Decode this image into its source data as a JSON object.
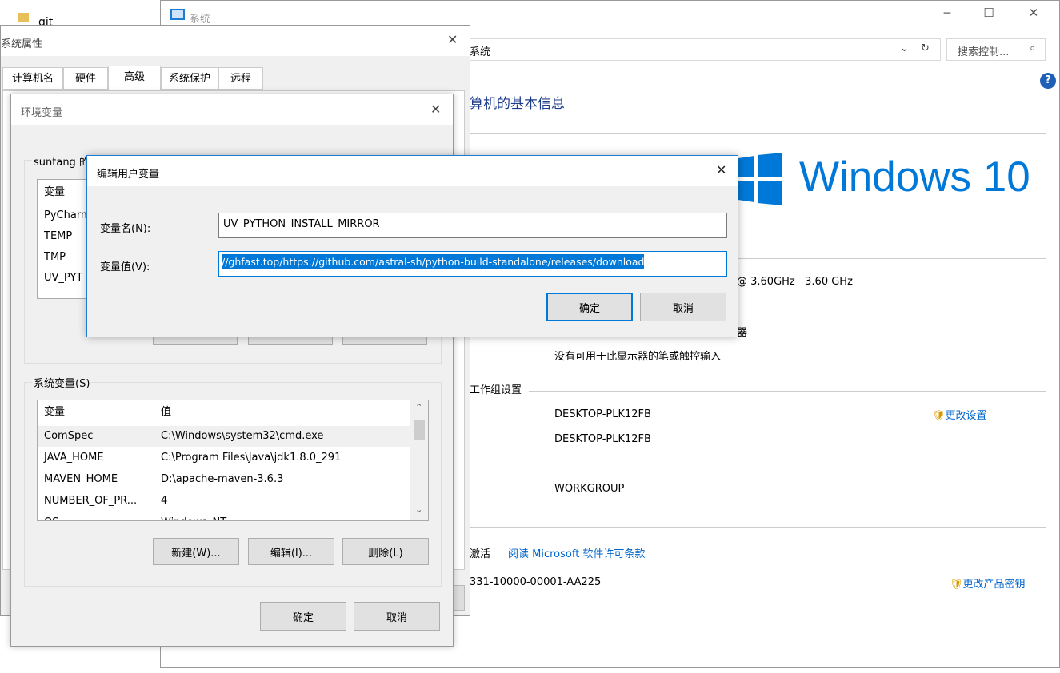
{
  "desktop": {
    "folder_label": "git"
  },
  "system_window": {
    "title": "系统",
    "address": "系统",
    "search_placeholder": "搜索控制... ",
    "heading": "算机的基本信息",
    "windows_logo_text": "Windows",
    "windows_logo_version": "10",
    "cpu_speed": "@ 3.60GHz   3.60 GHz",
    "partial_display": "器",
    "pen_touch": "没有可用于此显示器的笔或触控输入",
    "workgroup_section": "工作组设置",
    "computer_name": "DESKTOP-PLK12FB",
    "full_name": "DESKTOP-PLK12FB",
    "workgroup": "WORKGROUP",
    "change_settings": "更改设置",
    "activation_prefix": "激活",
    "license_link": "阅读 Microsoft 软件许可条款",
    "product_id": "331-10000-00001-AA225",
    "change_product_key": "更改产品密钥"
  },
  "sys_props": {
    "title": "系统属性",
    "tabs": [
      "计算机名",
      "硬件",
      "高级",
      "系统保护",
      "远程"
    ]
  },
  "env_dialog": {
    "title": "环境变量",
    "user_group_label": "suntang 的用户变量(U)",
    "user_header_var": "变量",
    "user_rows": [
      "PyCharm",
      "TEMP",
      "TMP",
      "UV_PYT"
    ],
    "system_group_label": "系统变量(S)",
    "sys_header_var": "变量",
    "sys_header_val": "值",
    "sys_rows": [
      {
        "name": "ComSpec",
        "value": "C:\\Windows\\system32\\cmd.exe"
      },
      {
        "name": "JAVA_HOME",
        "value": "C:\\Program Files\\Java\\jdk1.8.0_291"
      },
      {
        "name": "MAVEN_HOME",
        "value": "D:\\apache-maven-3.6.3"
      },
      {
        "name": "NUMBER_OF_PR...",
        "value": "4"
      },
      {
        "name": "OS",
        "value": "Windows_NT"
      }
    ],
    "new_btn": "新建(W)...",
    "edit_btn": "编辑(I)...",
    "delete_btn": "删除(L)",
    "ok_btn": "确定",
    "cancel_btn": "取消"
  },
  "edit_dialog": {
    "title": "编辑用户变量",
    "name_label": "变量名(N):",
    "value_label": "变量值(V):",
    "name_value": "UV_PYTHON_INSTALL_MIRROR",
    "value_value": "//ghfast.top/https://github.com/astral-sh/python-build-standalone/releases/download",
    "ok_btn": "确定",
    "cancel_btn": "取消"
  }
}
